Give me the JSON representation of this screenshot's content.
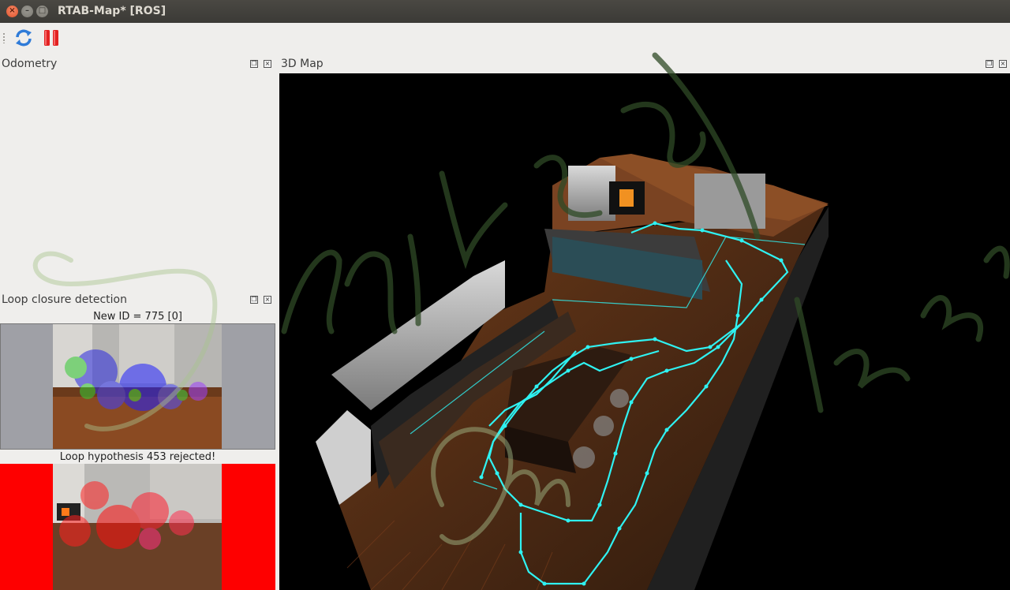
{
  "window": {
    "title": "RTAB-Map* [ROS]",
    "close_glyph": "×",
    "min_glyph": "–",
    "max_glyph": "□"
  },
  "toolbar": {
    "refresh_icon": "refresh-icon",
    "pause_icon": "pause-icon",
    "accent_red": "#e32222",
    "accent_blue": "#2f7bd8"
  },
  "docks": {
    "odometry": {
      "title": "Odometry"
    },
    "loop": {
      "title": "Loop closure detection",
      "new_id_text": "New ID = 775 [0]",
      "hypothesis_text": "Loop hypothesis 453 rejected!"
    },
    "map": {
      "title": "3D Map"
    },
    "float_glyph": "❐",
    "close_glyph": "×"
  },
  "colors": {
    "trajectory": "#2ff2f2",
    "map_background": "#000000",
    "rejected_background": "#fe0000"
  }
}
